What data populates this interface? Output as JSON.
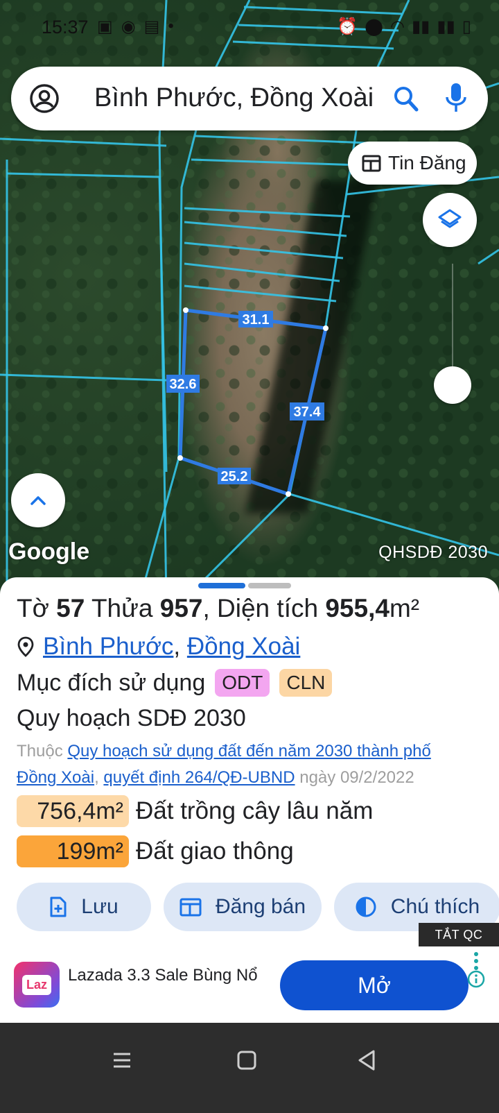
{
  "status_bar": {
    "time": "15:37",
    "left_icons": [
      "image-icon",
      "messenger-icon",
      "shop-icon",
      "dot-icon"
    ],
    "right_icons": [
      "alarm-icon",
      "location-icon",
      "wifi-icon",
      "signal-icon",
      "signal-icon",
      "battery-icon"
    ]
  },
  "search": {
    "query": "Bình Phước, Đồng Xoài"
  },
  "map": {
    "tin_dang_label": "Tin Đăng",
    "google_label": "Google",
    "layer_label": "QHSDĐ 2030",
    "edge_labels": [
      "31.1",
      "32.6",
      "37.4",
      "25.2"
    ]
  },
  "parcel": {
    "to_label": "Tờ",
    "to_value": "57",
    "thua_label": "Thửa",
    "thua_value": "957",
    "area_label": ", Diện tích",
    "area_value": "955,4",
    "area_unit": "m²",
    "province": "Bình Phước",
    "comma": ",",
    "district": "Đồng Xoài",
    "usage_label": "Mục đích sử dụng",
    "usage_badges": [
      "ODT",
      "CLN"
    ],
    "plan_title": "Quy hoạch SDĐ 2030",
    "plan_prefix": "Thuộc",
    "plan_link": "Quy hoạch sử dụng đất đến năm 2030 thành phố Đồng Xoài",
    "plan_comma": ",",
    "decision_link": "quyết định 264/QĐ-UBND",
    "decision_date": "ngày 09/2/2022",
    "areas": [
      {
        "value": "756,4m²",
        "label": "Đất trồng cây lâu năm"
      },
      {
        "value": "199m²",
        "label": "Đất giao thông"
      }
    ]
  },
  "actions": {
    "save": "Lưu",
    "sell": "Đăng bán",
    "legend": "Chú thích"
  },
  "ad": {
    "off_label": "TẮT QC",
    "logo_text": "Laz",
    "title": "Lazada 3.3 Sale Bùng Nổ",
    "open_label": "Mở"
  },
  "colors": {
    "parcel_outline": "#2f7be3",
    "grid_lines": "#34c4e8",
    "accent": "#1a5fcc",
    "odt": "#f3a6f0",
    "cln": "#fcd6a4",
    "area_1": "#fdd9a8",
    "area_2": "#fba53a"
  }
}
